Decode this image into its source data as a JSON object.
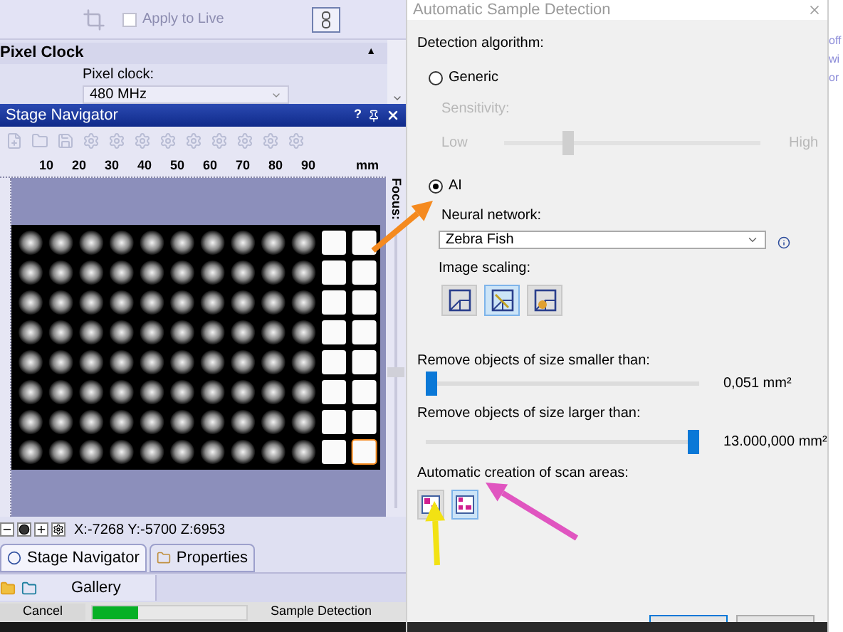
{
  "acquisition": {
    "apply_to_live": {
      "label": "Apply to Live",
      "checked": false,
      "disabled": true
    }
  },
  "pixel_clock": {
    "title": "Pixel Clock",
    "collapse_glyph": "▲",
    "label": "Pixel clock:",
    "value": "480 MHz"
  },
  "stage_navigator": {
    "title": "Stage Navigator",
    "help": "?",
    "ruler": [
      "10",
      "20",
      "30",
      "40",
      "50",
      "60",
      "70",
      "80",
      "90"
    ],
    "unit": "mm",
    "focus": {
      "label": "Focus:",
      "level": 0.5
    },
    "coordinates": "X:-7268 Y:-5700 Z:6953"
  },
  "tabs": [
    {
      "label": "Stage Navigator",
      "selected": true
    },
    {
      "label": "Properties",
      "selected": false
    }
  ],
  "gallery_tab": {
    "label": "Gallery"
  },
  "status_bar": {
    "cancel": "Cancel",
    "progress": {
      "level": 0.3
    },
    "text": "Sample Detection"
  },
  "dialog": {
    "title": "Automatic Sample Detection",
    "algorithm_label": "Detection algorithm:",
    "algorithms": [
      {
        "label": "Generic",
        "selected": false
      },
      {
        "label": "AI",
        "selected": true
      }
    ],
    "sensitivity": {
      "label": "Sensitivity:",
      "low": "Low",
      "high": "High",
      "level": 0.25,
      "disabled": true
    },
    "neural_network": {
      "label": "Neural network:",
      "value": "Zebra Fish"
    },
    "image_scaling": {
      "label": "Image scaling:",
      "buttons": [
        {
          "selected": false
        },
        {
          "selected": true
        },
        {
          "selected": false
        }
      ]
    },
    "min_size": {
      "label": "Remove objects of size smaller than:",
      "level": 0.02,
      "reading": "0,051 mm²"
    },
    "max_size": {
      "label": "Remove objects of size larger than:",
      "level": 0.98,
      "reading": "13.000,000 mm²"
    },
    "scan_areas": {
      "label": "Automatic creation of scan areas:",
      "buttons": [
        {
          "selected": false
        },
        {
          "selected": true
        }
      ]
    }
  },
  "background_text": [
    "off",
    "wi",
    "or"
  ],
  "annotations": [
    {
      "color": "#f58a1f"
    },
    {
      "color": "#f2e213"
    },
    {
      "color": "#e055c0"
    }
  ]
}
